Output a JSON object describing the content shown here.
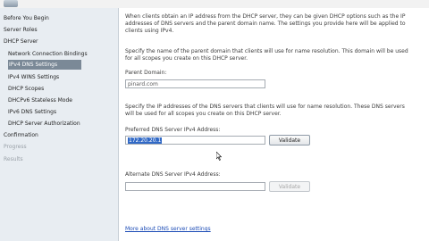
{
  "sidebar": {
    "items": [
      {
        "label": "Before You Begin"
      },
      {
        "label": "Server Roles"
      },
      {
        "label": "DHCP Server"
      },
      {
        "label": "Network Connection Bindings"
      },
      {
        "label": "IPv4 DNS Settings"
      },
      {
        "label": "IPv4 WINS Settings"
      },
      {
        "label": "DHCP Scopes"
      },
      {
        "label": "DHCPv6 Stateless Mode"
      },
      {
        "label": "IPv6 DNS Settings"
      },
      {
        "label": "DHCP Server Authorization"
      },
      {
        "label": "Confirmation"
      },
      {
        "label": "Progress"
      },
      {
        "label": "Results"
      }
    ]
  },
  "main": {
    "intro": "When clients obtain an IP address from the DHCP server, they can be given DHCP options such as the IP addresses of DNS servers and the parent domain name. The settings you provide here will be applied to clients using IPv4.",
    "domain_intro": "Specify the name of the parent domain that clients will use for name resolution. This domain will be used for all scopes you create on this DHCP server.",
    "parent_domain_label": "Parent Domain:",
    "parent_domain_value": "pinard.com",
    "dns_intro": "Specify the IP addresses of the DNS servers that clients will use for name resolution. These DNS servers will be used for all scopes you create on this DHCP server.",
    "preferred_label": "Preferred DNS Server IPv4 Address:",
    "preferred_value": "172.20.20.1",
    "validate_label": "Validate",
    "alternate_label": "Alternate DNS Server IPv4 Address:",
    "alternate_value": "",
    "validate2_label": "Validate",
    "more_link": "More about DNS server settings"
  },
  "colors": {
    "sidebar_bg": "#e8edf2",
    "selected_bg": "#7b8997",
    "link": "#1a4ab5",
    "selection": "#3169c6"
  }
}
